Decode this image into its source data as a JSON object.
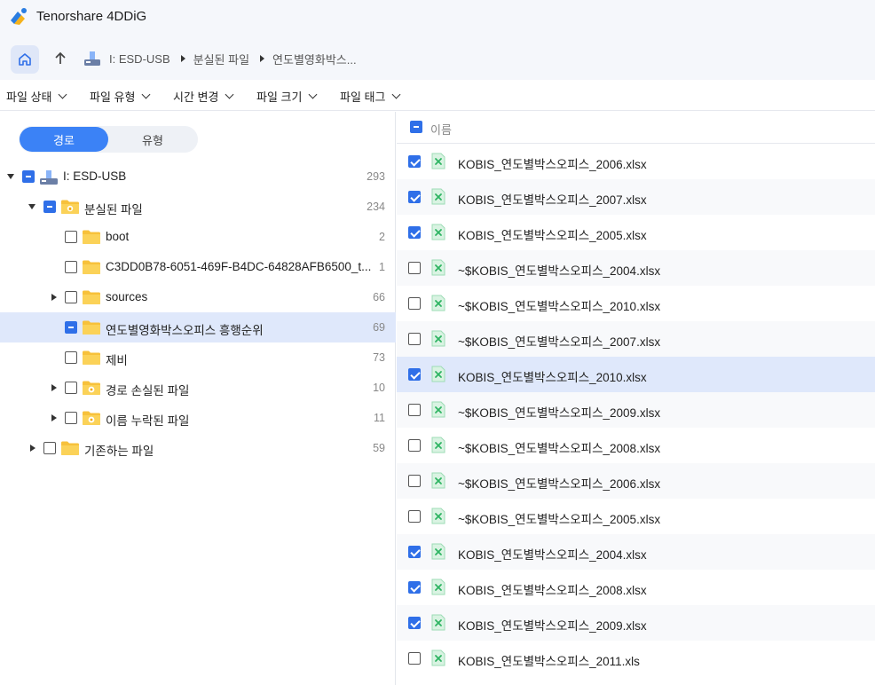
{
  "app": {
    "title": "Tenorshare 4DDiG"
  },
  "nav": {
    "breadcrumbs": [
      "I: ESD-USB",
      "분실된 파일",
      "연도별영화박스..."
    ]
  },
  "filters": [
    "파일 상태",
    "파일 유형",
    "시간 변경",
    "파일 크기",
    "파일 태그"
  ],
  "view_toggle": {
    "active": "경로",
    "inactive": "유형"
  },
  "tree": [
    {
      "label": "I: ESD-USB",
      "count": "293",
      "state": "partial",
      "expand": "open",
      "icon": "usb-drive-icon"
    },
    {
      "label": "분실된 파일",
      "count": "234",
      "state": "partial",
      "expand": "open",
      "icon": "lost-folder-icon"
    },
    {
      "label": "boot",
      "count": "2",
      "state": "unchecked",
      "expand": "none",
      "icon": "folder-icon"
    },
    {
      "label": "C3DD0B78-6051-469F-B4DC-64828AFB6500_t...",
      "count": "1",
      "state": "unchecked",
      "expand": "none",
      "icon": "folder-icon"
    },
    {
      "label": "sources",
      "count": "66",
      "state": "unchecked",
      "expand": "closed",
      "icon": "folder-icon"
    },
    {
      "label": "연도별영화박스오피스 흥행순위",
      "count": "69",
      "state": "partial",
      "expand": "none",
      "icon": "folder-icon",
      "selected": true
    },
    {
      "label": "제비",
      "count": "73",
      "state": "unchecked",
      "expand": "none",
      "icon": "folder-icon"
    },
    {
      "label": "경로 손실된 파일",
      "count": "10",
      "state": "unchecked",
      "expand": "closed",
      "icon": "special-folder-icon"
    },
    {
      "label": "이름 누락된 파일",
      "count": "11",
      "state": "unchecked",
      "expand": "closed",
      "icon": "special-folder-icon"
    },
    {
      "label": "기존하는 파일",
      "count": "59",
      "state": "unchecked",
      "expand": "closed",
      "icon": "folder-icon"
    }
  ],
  "file_list": {
    "header": "이름",
    "header_state": "partial",
    "files": [
      {
        "name": "KOBIS_연도별박스오피스_2006.xlsx",
        "checked": true
      },
      {
        "name": "KOBIS_연도별박스오피스_2007.xlsx",
        "checked": true
      },
      {
        "name": "KOBIS_연도별박스오피스_2005.xlsx",
        "checked": true
      },
      {
        "name": "~$KOBIS_연도별박스오피스_2004.xlsx",
        "checked": false
      },
      {
        "name": "~$KOBIS_연도별박스오피스_2010.xlsx",
        "checked": false
      },
      {
        "name": "~$KOBIS_연도별박스오피스_2007.xlsx",
        "checked": false
      },
      {
        "name": "KOBIS_연도별박스오피스_2010.xlsx",
        "checked": true,
        "selected": true
      },
      {
        "name": "~$KOBIS_연도별박스오피스_2009.xlsx",
        "checked": false
      },
      {
        "name": "~$KOBIS_연도별박스오피스_2008.xlsx",
        "checked": false
      },
      {
        "name": "~$KOBIS_연도별박스오피스_2006.xlsx",
        "checked": false
      },
      {
        "name": "~$KOBIS_연도별박스오피스_2005.xlsx",
        "checked": false
      },
      {
        "name": "KOBIS_연도별박스오피스_2004.xlsx",
        "checked": true
      },
      {
        "name": "KOBIS_연도별박스오피스_2008.xlsx",
        "checked": true
      },
      {
        "name": "KOBIS_연도별박스오피스_2009.xlsx",
        "checked": true
      },
      {
        "name": "KOBIS_연도별박스오피스_2011.xls",
        "checked": false
      }
    ]
  },
  "colors": {
    "accent": "#3b82f6",
    "checkbox": "#2f6fe8",
    "selection": "#dfe8fb",
    "folder": "#f7c13b",
    "excel": "#3fbf6f"
  }
}
